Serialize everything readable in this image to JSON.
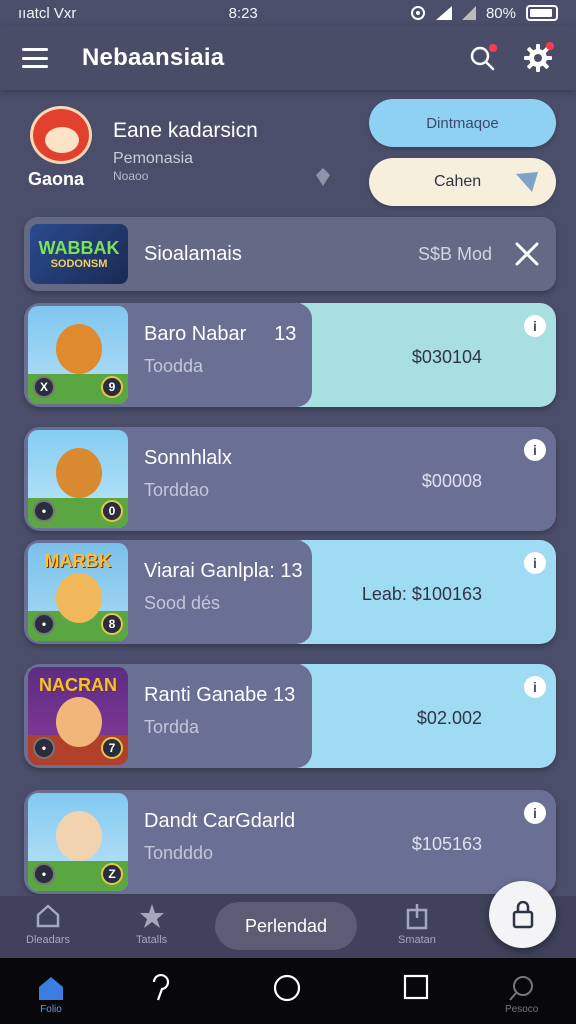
{
  "status": {
    "carrier": "ııatcl Vxr",
    "time": "8:23",
    "battery": "80%"
  },
  "header": {
    "title": "Nebaansiaia"
  },
  "profile": {
    "logo_text": "Gaona",
    "name": "Eane kadarsicn",
    "subtitle": "Pemonasia",
    "subtitle2": "Noaoo",
    "primary_button": "Dintmaqoe",
    "secondary_button": "Cahen"
  },
  "featured": {
    "thumb_line1": "WABBAK",
    "thumb_line2": "SODONSM",
    "label": "Sioalamais",
    "price": "S$B Mod"
  },
  "games": [
    {
      "name": "Baro Nabar",
      "badge": "13",
      "sub": "Toodda",
      "price": "$030104",
      "thumb_left": "X",
      "thumb_right": "9",
      "highlight": "#a8dfe0"
    },
    {
      "name": "Sonnhlalx",
      "badge": "",
      "sub": "Torddao",
      "price": "$00008",
      "thumb_left": "•",
      "thumb_right": "0",
      "highlight": ""
    },
    {
      "name": "Viarai Ganlpla:",
      "badge": "13",
      "sub": "Sood dés",
      "price": "Leab: $100163",
      "thumb_left": "•",
      "thumb_right": "8",
      "highlight": "#9fdcf4",
      "art": "MARBK"
    },
    {
      "name": "Ranti Ganabe",
      "badge": "13",
      "sub": "Tordda",
      "price": "$02.002",
      "thumb_left": "•",
      "thumb_right": "7",
      "highlight": "#9fdcf4",
      "art": "NACRAN"
    },
    {
      "name": "Dandt CarGdarld",
      "badge": "",
      "sub": "Tondddo",
      "price": "$105163",
      "thumb_left": "•",
      "thumb_right": "Z",
      "highlight": ""
    }
  ],
  "bottom_nav": {
    "item1": "Dleadars",
    "item2": "Tatalls",
    "pill": "Perlendad",
    "item4": "Smatan"
  },
  "system_nav": {
    "home_label": "Folio",
    "search_label": "Pesoco"
  },
  "colors": {
    "background": "#4b4e6a",
    "card": "#6a6f94",
    "accent": "#8fd1f3"
  }
}
